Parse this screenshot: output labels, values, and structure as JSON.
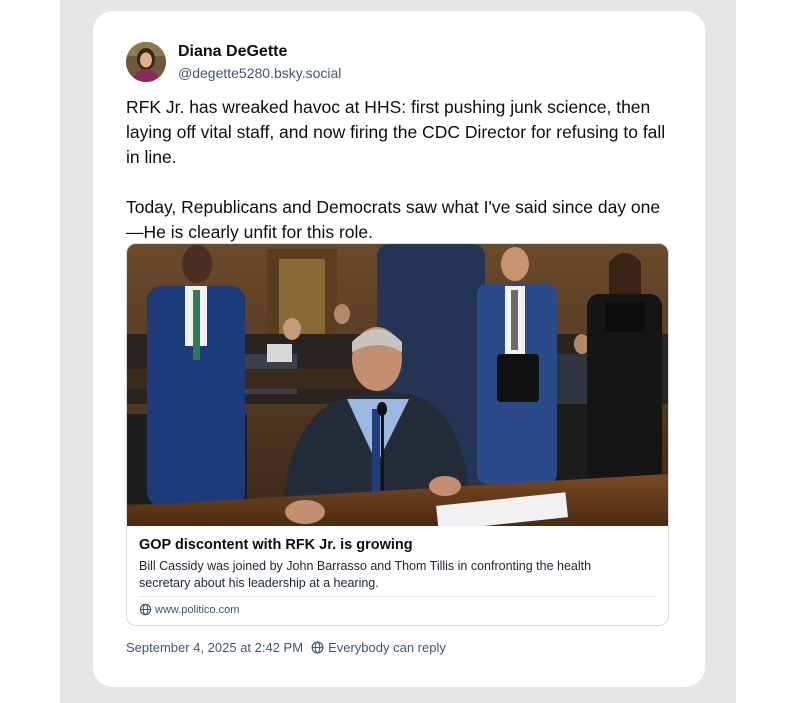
{
  "post": {
    "author_name": "Diana DeGette",
    "author_handle": "@degette5280.bsky.social",
    "avatar_icon": "avatar-photo",
    "paragraphs": [
      "RFK Jr. has wreaked havoc at HHS: first pushing junk science, then laying off vital staff, and now firing the CDC Director for refusing to fall in line.",
      "Today, Republicans and Democrats saw what I've said since day one—He is clearly unfit for this role."
    ],
    "embed": {
      "image_icon": "news-photo",
      "title": "GOP discontent with RFK Jr. is growing",
      "description": "Bill Cassidy was joined by John Barrasso and Thom Tillis in confronting the health secretary about his leadership at a hearing.",
      "domain": "www.politico.com",
      "domain_icon": "globe-icon"
    },
    "timestamp": "September 4, 2025 at 2:42 PM",
    "reply_setting": "Everybody can reply",
    "reply_icon": "reply-setting-icon"
  },
  "colors": {
    "background_panel": "#e6e6e6",
    "card": "#ffffff",
    "text_primary": "#0b0f14",
    "text_secondary": "#42576c",
    "border": "#d4dbe2"
  }
}
